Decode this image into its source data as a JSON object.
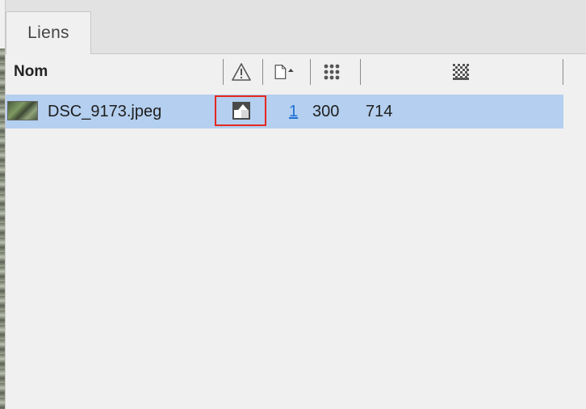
{
  "tabs": [
    {
      "label": "Liens",
      "active": true
    }
  ],
  "columns": {
    "name": "Nom",
    "status_icon": "warning-icon",
    "page_icon": "page-sort-icon",
    "ppi_icon": "dot-grid-icon",
    "effective_ppi_icon": "halftone-grid-icon"
  },
  "links": [
    {
      "thumbnail": "image-thumbnail",
      "name": "DSC_9173.jpeg",
      "status_icon": "embedded-link-icon",
      "page": "1",
      "ppi": "300",
      "effective_ppi": "714",
      "selected": true
    }
  ],
  "colors": {
    "selection": "#b4cfef",
    "highlight_box": "#e5281f",
    "link": "#1e6fd6"
  }
}
